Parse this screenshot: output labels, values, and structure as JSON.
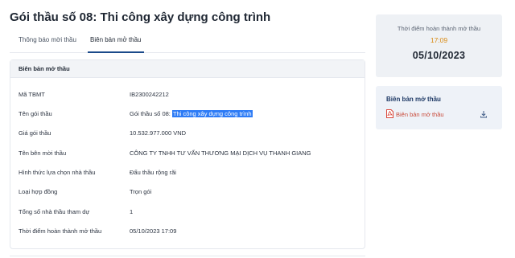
{
  "page_title": "Gói thầu số 08: Thi công xây dựng công trình",
  "tabs": [
    {
      "label": "Thông báo mời thầu",
      "active": false
    },
    {
      "label": "Biên bản mở thầu",
      "active": true
    }
  ],
  "card": {
    "header": "Biên bản mở thầu",
    "rows": [
      {
        "key": "Mã TBMT",
        "value": "IB2300242212"
      },
      {
        "key": "Tên gói thầu",
        "value_prefix": "Gói thầu số 08: ",
        "value_highlight": "Thi công xây dựng công trình"
      },
      {
        "key": "Giá gói thầu",
        "value": "10.532.977.000 VND"
      },
      {
        "key": "Tên bên mời thầu",
        "value": "CÔNG TY TNHH TƯ VẤN THƯƠNG MẠI DỊCH VỤ THANH GIANG"
      },
      {
        "key": "Hình thức lựa chọn nhà thầu",
        "value": "Đấu thầu rộng rãi"
      },
      {
        "key": "Loại hợp đồng",
        "value": "Trọn gói"
      },
      {
        "key": "Tổng số nhà thầu tham dự",
        "value": "1"
      },
      {
        "key": "Thời điểm hoàn thành mở thầu",
        "value": "05/10/2023 17:09"
      }
    ]
  },
  "deadline": {
    "label": "Thời điểm hoàn thành mở thầu",
    "time": "17:09",
    "date": "05/10/2023"
  },
  "document": {
    "title": "Biên bản mở thầu",
    "file_label": "Biên bản mở thầu",
    "file_icon": "pdf-icon",
    "action_icon": "download-icon"
  },
  "colors": {
    "accent": "#1b4a8a",
    "selection": "#2e7cf6",
    "time": "#d98a12",
    "pdf": "#c94b3b"
  }
}
